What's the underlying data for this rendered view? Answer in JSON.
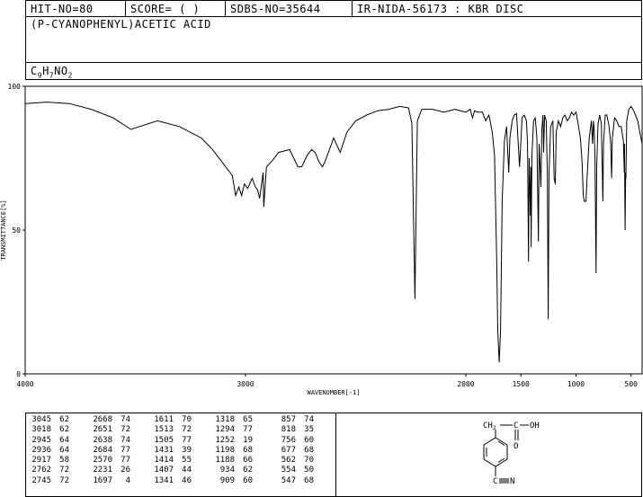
{
  "header": {
    "hit_no": "HIT-NO=80",
    "score": "SCORE=  (   )",
    "sdbs_no": "SDBS-NO=35644",
    "ir_info": "IR-NIDA-56173 : KBR DISC"
  },
  "compound": {
    "name": "(P-CYANOPHENYL)ACETIC ACID",
    "formula_parts": [
      "C",
      "9",
      "H",
      "7",
      "NO",
      "2"
    ]
  },
  "structure_labels": {
    "ch2": "CH",
    "ch2_sub": "2",
    "c": "C",
    "o": "O",
    "oh": "OH",
    "cn": "C",
    "n": "N"
  },
  "chart_data": {
    "type": "line",
    "xlabel": "WAVENUMBER[-1]",
    "ylabel": "TRANSMITTANCE[%]",
    "xlim": [
      4000,
      400
    ],
    "ylim": [
      0,
      100
    ],
    "x_ticks": [
      4000,
      3000,
      2000,
      1500,
      1000,
      500
    ],
    "x_tick_labels": [
      "4000",
      "3000",
      "2000",
      "1500",
      "1000",
      "500"
    ],
    "y_ticks": [
      0,
      50,
      100
    ],
    "y_tick_labels": [
      "0",
      "50",
      "100"
    ],
    "series": [
      {
        "color": "#000000",
        "points": [
          [
            4000,
            94
          ],
          [
            3900,
            94.5
          ],
          [
            3800,
            94
          ],
          [
            3700,
            92
          ],
          [
            3600,
            89
          ],
          [
            3520,
            85
          ],
          [
            3460,
            86.5
          ],
          [
            3400,
            88
          ],
          [
            3300,
            86
          ],
          [
            3200,
            82
          ],
          [
            3150,
            78
          ],
          [
            3100,
            73
          ],
          [
            3060,
            69
          ],
          [
            3045,
            62
          ],
          [
            3030,
            65
          ],
          [
            3018,
            62
          ],
          [
            3005,
            66
          ],
          [
            2990,
            64.5
          ],
          [
            2970,
            68
          ],
          [
            2955,
            65
          ],
          [
            2945,
            64
          ],
          [
            2936,
            61
          ],
          [
            2920,
            70
          ],
          [
            2917,
            58
          ],
          [
            2905,
            72
          ],
          [
            2880,
            74
          ],
          [
            2850,
            77
          ],
          [
            2800,
            78
          ],
          [
            2762,
            72
          ],
          [
            2745,
            72
          ],
          [
            2720,
            76
          ],
          [
            2700,
            78
          ],
          [
            2684,
            77
          ],
          [
            2668,
            74
          ],
          [
            2651,
            72
          ],
          [
            2638,
            74
          ],
          [
            2600,
            82
          ],
          [
            2570,
            77
          ],
          [
            2540,
            84
          ],
          [
            2500,
            88
          ],
          [
            2450,
            90
          ],
          [
            2400,
            91.5
          ],
          [
            2350,
            92
          ],
          [
            2300,
            93
          ],
          [
            2260,
            92.5
          ],
          [
            2245,
            87
          ],
          [
            2231,
            26
          ],
          [
            2220,
            88
          ],
          [
            2200,
            92
          ],
          [
            2150,
            92
          ],
          [
            2100,
            91
          ],
          [
            2050,
            92
          ],
          [
            2000,
            91
          ],
          [
            1960,
            92
          ],
          [
            1940,
            89
          ],
          [
            1920,
            91.5
          ],
          [
            1900,
            91
          ],
          [
            1850,
            91
          ],
          [
            1820,
            88
          ],
          [
            1790,
            90
          ],
          [
            1760,
            84
          ],
          [
            1740,
            76
          ],
          [
            1720,
            40
          ],
          [
            1710,
            15
          ],
          [
            1697,
            4
          ],
          [
            1685,
            15
          ],
          [
            1670,
            60
          ],
          [
            1650,
            81
          ],
          [
            1630,
            86
          ],
          [
            1611,
            70
          ],
          [
            1600,
            82
          ],
          [
            1580,
            88
          ],
          [
            1560,
            90
          ],
          [
            1540,
            90.5
          ],
          [
            1513,
            72
          ],
          [
            1505,
            77
          ],
          [
            1490,
            89
          ],
          [
            1470,
            90
          ],
          [
            1450,
            88
          ],
          [
            1440,
            80
          ],
          [
            1431,
            39
          ],
          [
            1425,
            75
          ],
          [
            1414,
            55
          ],
          [
            1410,
            72
          ],
          [
            1407,
            44
          ],
          [
            1400,
            76
          ],
          [
            1385,
            88
          ],
          [
            1370,
            89
          ],
          [
            1355,
            82
          ],
          [
            1341,
            46
          ],
          [
            1335,
            80
          ],
          [
            1318,
            65
          ],
          [
            1310,
            85
          ],
          [
            1300,
            90
          ],
          [
            1294,
            77
          ],
          [
            1285,
            90
          ],
          [
            1270,
            88
          ],
          [
            1260,
            70
          ],
          [
            1252,
            19
          ],
          [
            1245,
            70
          ],
          [
            1230,
            86
          ],
          [
            1210,
            88
          ],
          [
            1198,
            68
          ],
          [
            1188,
            66
          ],
          [
            1180,
            84
          ],
          [
            1160,
            88
          ],
          [
            1140,
            86
          ],
          [
            1120,
            89
          ],
          [
            1100,
            90
          ],
          [
            1080,
            88
          ],
          [
            1060,
            89
          ],
          [
            1040,
            91
          ],
          [
            1020,
            90
          ],
          [
            1000,
            91
          ],
          [
            985,
            88
          ],
          [
            960,
            82
          ],
          [
            945,
            74
          ],
          [
            934,
            62
          ],
          [
            925,
            60
          ],
          [
            909,
            60
          ],
          [
            900,
            68
          ],
          [
            880,
            82
          ],
          [
            860,
            88
          ],
          [
            850,
            80
          ],
          [
            842,
            88
          ],
          [
            835,
            85
          ],
          [
            828,
            75
          ],
          [
            818,
            35
          ],
          [
            812,
            72
          ],
          [
            800,
            87
          ],
          [
            785,
            90
          ],
          [
            770,
            87
          ],
          [
            756,
            60
          ],
          [
            750,
            80
          ],
          [
            735,
            90
          ],
          [
            720,
            90
          ],
          [
            700,
            86
          ],
          [
            685,
            80
          ],
          [
            677,
            68
          ],
          [
            670,
            82
          ],
          [
            650,
            89
          ],
          [
            630,
            88
          ],
          [
            610,
            86
          ],
          [
            590,
            86
          ],
          [
            570,
            81
          ],
          [
            562,
            70
          ],
          [
            560,
            80
          ],
          [
            554,
            50
          ],
          [
            549,
            70
          ],
          [
            547,
            68
          ],
          [
            540,
            88
          ],
          [
            520,
            92
          ],
          [
            500,
            93
          ],
          [
            470,
            91
          ],
          [
            440,
            88
          ],
          [
            420,
            84
          ],
          [
            400,
            80
          ]
        ]
      }
    ]
  },
  "peak_table": [
    [
      [
        "3045",
        "62"
      ],
      [
        "3018",
        "62"
      ],
      [
        "2945",
        "64"
      ],
      [
        "2936",
        "64"
      ],
      [
        "2917",
        "58"
      ],
      [
        "2762",
        "72"
      ],
      [
        "2745",
        "72"
      ]
    ],
    [
      [
        "2668",
        "74"
      ],
      [
        "2651",
        "72"
      ],
      [
        "2638",
        "74"
      ],
      [
        "2684",
        "77"
      ],
      [
        "2570",
        "77"
      ],
      [
        "2231",
        "26"
      ],
      [
        "1697",
        "4"
      ]
    ],
    [
      [
        "1611",
        "70"
      ],
      [
        "1513",
        "72"
      ],
      [
        "1505",
        "77"
      ],
      [
        "1431",
        "39"
      ],
      [
        "1414",
        "55"
      ],
      [
        "1407",
        "44"
      ],
      [
        "1341",
        "46"
      ]
    ],
    [
      [
        "1318",
        "65"
      ],
      [
        "1294",
        "77"
      ],
      [
        "1252",
        "19"
      ],
      [
        "1198",
        "68"
      ],
      [
        "1188",
        "66"
      ],
      [
        "934",
        "62"
      ],
      [
        "909",
        "60"
      ]
    ],
    [
      [
        "857",
        "74"
      ],
      [
        "818",
        "35"
      ],
      [
        "756",
        "60"
      ],
      [
        "677",
        "68"
      ],
      [
        "562",
        "70"
      ],
      [
        "554",
        "50"
      ],
      [
        "547",
        "68"
      ]
    ]
  ]
}
